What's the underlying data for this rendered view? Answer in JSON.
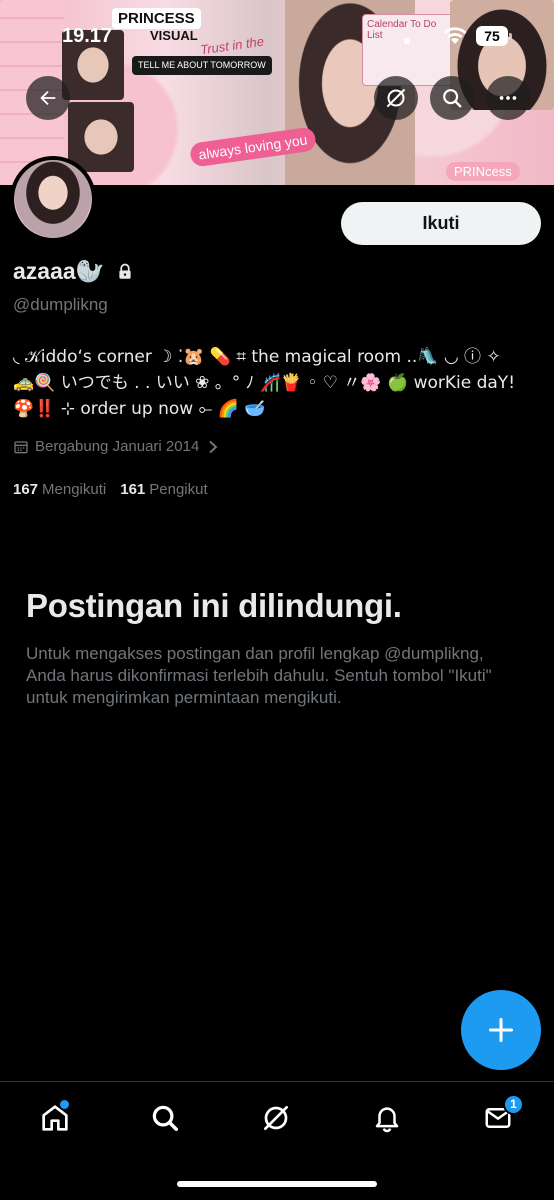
{
  "status_bar": {
    "time": "19.17",
    "battery": "75"
  },
  "banner": {
    "princess_label": "PRINCESS",
    "visual_label": "VISUAL",
    "tomorrow_label": "TELL ME ABOUT TOMORROW",
    "trust_label": "Trust in the",
    "always_label": "always loving you",
    "calendar_label": "Calendar To Do List",
    "princess2_label": "PRINcess"
  },
  "profile": {
    "display_name": "azaaa🦭",
    "handle": "@dumplikng",
    "follow_label": "Ikuti",
    "bio_lines": [
      "◟ 𝒦iddo‘s corner ☽ ⁚🐹 💊 ⌗ the magical room ..🛝 ◡ ⓘ ✧",
      "🚕🍭 いつでも . . いい ❀ 。° ﾉ 🎢🍟 ◦ ♡ 〃🌸 🍏 worKie daY!",
      "🍄‼️ ⊹ order up now ⟜ 🌈 🥣"
    ],
    "joined": "Bergabung Januari 2014",
    "following_count": "167",
    "following_label": "Mengikuti",
    "followers_count": "161",
    "followers_label": "Pengikut"
  },
  "protected": {
    "title": "Postingan ini dilindungi.",
    "body": "Untuk mengakses postingan dan profil lengkap @dumplikng, Anda harus dikonfirmasi terlebih dahulu. Sentuh tombol \"Ikuti\" untuk mengirimkan permintaan mengikuti."
  },
  "tabbar": {
    "messages_badge": "1"
  },
  "colors": {
    "accent": "#1d9bf0",
    "background": "#000000",
    "text_primary": "#e7e9ea",
    "text_secondary": "#71767b"
  }
}
